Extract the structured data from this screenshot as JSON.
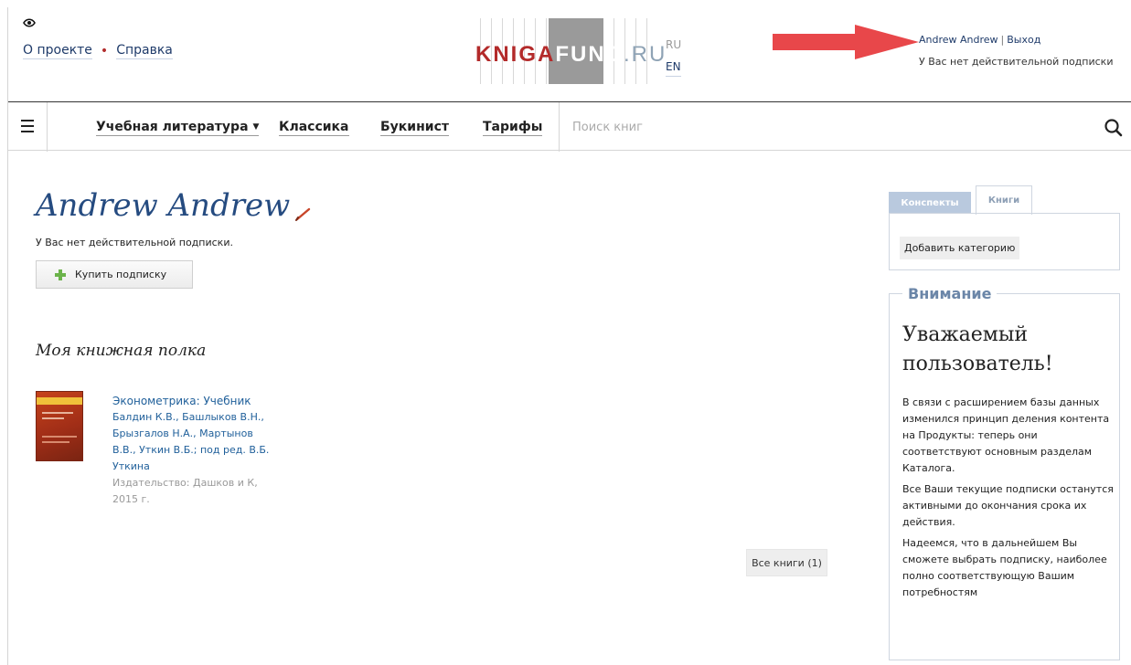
{
  "header": {
    "links": [
      "О проекте",
      "Справка"
    ],
    "logo": {
      "kniga": "KNIGA",
      "fund": "FUND",
      "ru": ".RU"
    },
    "lang": {
      "ru": "RU",
      "en": "EN"
    },
    "user": {
      "name": "Andrew Andrew",
      "separator": "|",
      "logout": "Выход"
    },
    "subscription_status": "У Вас нет действительной подписки"
  },
  "nav": {
    "items": [
      {
        "label": "Учебная литература",
        "caret": "▼"
      },
      {
        "label": "Классика"
      },
      {
        "label": "Букинист"
      },
      {
        "label": "Тарифы"
      }
    ],
    "search_placeholder": "Поиск книг"
  },
  "profile": {
    "name": "Andrew Andrew",
    "subscription_status": "У Вас нет действительной подписки.",
    "buy_button": "Купить подписку"
  },
  "shelf": {
    "title": "Моя книжная полка",
    "books": [
      {
        "title": "Эконометрика: Учебник",
        "authors": "Балдин К.В., Башлыков В.Н., Брызгалов Н.А., Мартынов В.В., Уткин В.Б.; под ред. В.Б. Уткина",
        "publisher": "Издательство: Дашков и К, 2015 г."
      }
    ],
    "all_books": "Все книги (1)"
  },
  "sidebar": {
    "tabs": [
      "Конспекты",
      "Книги"
    ],
    "add_category": "Добавить категорию",
    "attention": {
      "legend": "Внимание",
      "heading": "Уважаемый пользователь!",
      "paragraphs": [
        "В связи с расширением базы данных изменился принцип деления контента на Продукты: теперь они соответствуют основным разделам Каталога.",
        "Все Ваши текущие подписки останутся активными до окончания срока их действия.",
        "Надеемся, что в дальнейшем Вы сможете выбрать подписку, наиболее полно соответствующую Вашим потребностям"
      ]
    }
  },
  "colors": {
    "accent_red": "#b32a2a",
    "link_blue": "#1f3b6a",
    "name_blue": "#254b80",
    "arrow_red": "#e8474a"
  }
}
